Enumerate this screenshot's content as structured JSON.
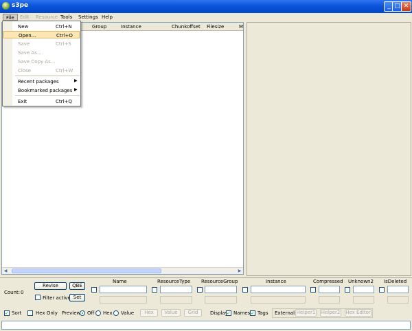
{
  "window": {
    "title": "s3pe"
  },
  "menubar": {
    "items": [
      "File",
      "Edit",
      "Resource",
      "Tools",
      "Settings",
      "Help"
    ]
  },
  "file_menu": {
    "new": {
      "label": "New",
      "shortcut": "Ctrl+N"
    },
    "open": {
      "label": "Open...",
      "shortcut": "Ctrl+O"
    },
    "save": {
      "label": "Save",
      "shortcut": "Ctrl+S"
    },
    "save_as": {
      "label": "Save As..."
    },
    "save_copy_as": {
      "label": "Save Copy As..."
    },
    "close": {
      "label": "Close",
      "shortcut": "Ctrl+W"
    },
    "recent": {
      "label": "Recent packages"
    },
    "bookmarked": {
      "label": "Bookmarked packages"
    },
    "exit": {
      "label": "Exit",
      "shortcut": "Ctrl+Q"
    }
  },
  "list": {
    "columns": [
      "Group",
      "Instance",
      "Chunkoffset",
      "Filesize",
      "M"
    ]
  },
  "bottom": {
    "count_label": "Count:",
    "count_value": "0",
    "revise": "Revise",
    "qbe": "QBE",
    "filter_active": "Filter active",
    "set": "Set",
    "filter_headers": [
      "Name",
      "ResourceType",
      "ResourceGroup",
      "Instance",
      "Compressed",
      "Unknown2",
      "IsDeleted"
    ],
    "sort": "Sort",
    "hex_only": "Hex Only",
    "preview_label": "Preview:",
    "preview_off": "Off",
    "preview_hex": "Hex",
    "preview_value": "Value",
    "hex_btn": "Hex",
    "value_btn": "Value",
    "grid_btn": "Grid",
    "display_label": "Display:",
    "names": "Names",
    "tags": "Tags",
    "external_label": "External:",
    "helper1": "Helper1",
    "helper2": "Helper2",
    "hex_editor": "Hex Editor"
  }
}
